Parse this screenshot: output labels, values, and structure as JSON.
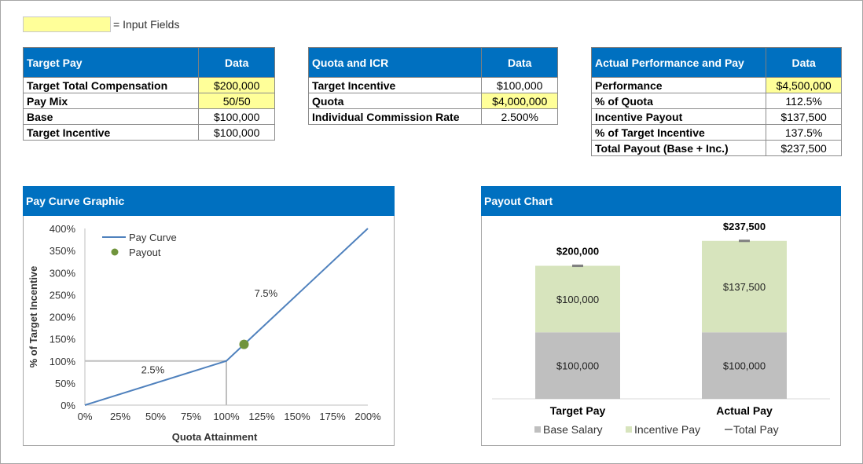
{
  "legend_key": {
    "label": "= Input Fields",
    "color": "#ffff99"
  },
  "target_pay": {
    "header": "Target Pay",
    "data_header": "Data",
    "rows": [
      {
        "label": "Target Total Compensation",
        "value": "$200,000",
        "input": true
      },
      {
        "label": "Pay Mix",
        "value": "50/50",
        "input": true
      },
      {
        "label": "Base",
        "value": "$100,000",
        "input": false
      },
      {
        "label": "Target Incentive",
        "value": "$100,000",
        "input": false
      }
    ]
  },
  "quota_icr": {
    "header": "Quota and ICR",
    "data_header": "Data",
    "rows": [
      {
        "label": "Target Incentive",
        "value": "$100,000",
        "input": false
      },
      {
        "label": "Quota",
        "value": "$4,000,000",
        "input": true
      },
      {
        "label": "Individual Commission Rate",
        "value": "2.500%",
        "input": false
      }
    ]
  },
  "actual_perf": {
    "header": "Actual Performance and Pay",
    "data_header": "Data",
    "rows": [
      {
        "label": "Performance",
        "value": "$4,500,000",
        "input": true
      },
      {
        "label": "% of Quota",
        "value": "112.5%",
        "input": false
      },
      {
        "label": "Incentive Payout",
        "value": "$137,500",
        "input": false
      },
      {
        "label": "% of Target Incentive",
        "value": "137.5%",
        "input": false
      },
      {
        "label": "Total Payout (Base + Inc.)",
        "value": "$237,500",
        "input": false
      }
    ]
  },
  "pay_curve_panel": {
    "title": "Pay Curve Graphic"
  },
  "payout_panel": {
    "title": "Payout Chart"
  },
  "chart_data": [
    {
      "type": "line",
      "xlabel": "Quota Attainment",
      "ylabel": "% of Target Incentive",
      "xlim": [
        0,
        200
      ],
      "ylim": [
        0,
        400
      ],
      "x_ticks": [
        "0%",
        "25%",
        "50%",
        "75%",
        "100%",
        "125%",
        "150%",
        "175%",
        "200%"
      ],
      "y_ticks": [
        "0%",
        "50%",
        "100%",
        "150%",
        "200%",
        "250%",
        "300%",
        "350%",
        "400%"
      ],
      "series": [
        {
          "name": "Pay Curve",
          "x": [
            0,
            100,
            200
          ],
          "y": [
            0,
            100,
            400
          ],
          "color": "#4f81bd"
        },
        {
          "name": "Payout",
          "x": [
            112.5
          ],
          "y": [
            137.5
          ],
          "color": "#70943c",
          "marker": "circle"
        }
      ],
      "reference_lines": {
        "x": 100,
        "y": 100,
        "color": "#bfbfbf"
      },
      "annotations": [
        {
          "text": "2.5%",
          "x": 48,
          "y": 72
        },
        {
          "text": "7.5%",
          "x": 128,
          "y": 245
        }
      ],
      "legend_position": "top-left"
    },
    {
      "type": "bar",
      "stacked": true,
      "categories": [
        "Target Pay",
        "Actual Pay"
      ],
      "series": [
        {
          "name": "Base Salary",
          "values": [
            100000,
            100000
          ],
          "labels": [
            "$100,000",
            "$100,000"
          ],
          "color": "#bfbfbf"
        },
        {
          "name": "Incentive Pay",
          "values": [
            100000,
            137500
          ],
          "labels": [
            "$100,000",
            "$137,500"
          ],
          "color": "#d7e4bd"
        },
        {
          "name": "Total Pay",
          "values": [
            200000,
            237500
          ],
          "labels": [
            "$200,000",
            "$237,500"
          ],
          "color": "#7f7f7f",
          "marker": "dash"
        }
      ],
      "ylim": [
        0,
        275000
      ],
      "legend_position": "bottom"
    }
  ]
}
